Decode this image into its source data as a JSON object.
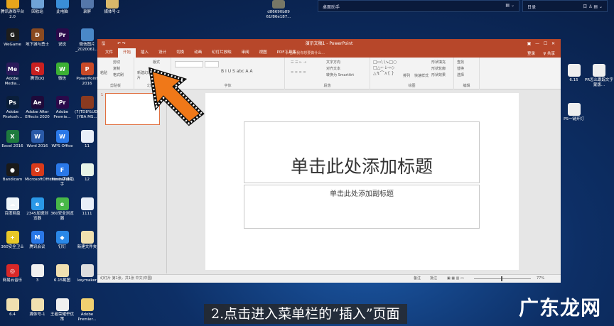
{
  "desktop": {
    "top_icons": [
      {
        "label": "腾讯游戏平台 2.0",
        "color": "#e7a51c"
      },
      {
        "label": "回收站",
        "color": "#6fa3d8"
      },
      {
        "label": "此电脑",
        "color": "#3a8ed8"
      },
      {
        "label": "录屏",
        "color": "#5577aa"
      },
      {
        "label": "媒体号-2",
        "color": "#d9b86a"
      }
    ],
    "left_icons": [
      {
        "label": "WeGame",
        "glyph": "G",
        "color": "#1d1d1d"
      },
      {
        "label": "地下城与勇士",
        "glyph": "D",
        "color": "#8a4a20"
      },
      {
        "label": "说说",
        "glyph": "Pr",
        "color": "#2a0a4a"
      },
      {
        "label": "微信图片_2020061...",
        "glyph": "",
        "color": "#4a88c8"
      },
      {
        "label": "Adobe Media...",
        "glyph": "Me",
        "color": "#2a1a5a"
      },
      {
        "label": "腾讯QQ",
        "glyph": "Q",
        "color": "#c82020"
      },
      {
        "label": "微信",
        "glyph": "W",
        "color": "#3cb034"
      },
      {
        "label": "PowerPoint 2016",
        "glyph": "P",
        "color": "#c84a28"
      },
      {
        "label": "Adobe Photosh...",
        "glyph": "Ps",
        "color": "#0a1e3a"
      },
      {
        "label": "Adobe After Effects 2020",
        "glyph": "Ae",
        "color": "#1e0a3a"
      },
      {
        "label": "Adobe Premie...",
        "glyph": "Pr",
        "color": "#2a0a4a"
      },
      {
        "label": "(7)TD8%UD~[YBA MS...",
        "glyph": "",
        "color": "#8a3a20"
      },
      {
        "label": "Excel 2016",
        "glyph": "X",
        "color": "#1e7a3e"
      },
      {
        "label": "Word 2016",
        "glyph": "W",
        "color": "#2a5aa8"
      },
      {
        "label": "WPS Office",
        "glyph": "W",
        "color": "#2a78e8"
      },
      {
        "label": "11",
        "glyph": "",
        "color": "#e8eef8"
      },
      {
        "label": "Bandicam",
        "glyph": "●",
        "color": "#1a1a1a"
      },
      {
        "label": "MicrosoftOfficeInstallati...",
        "glyph": "O",
        "color": "#d83a1a"
      },
      {
        "label": "iFonts字体助手",
        "glyph": "F",
        "color": "#2a78e8"
      },
      {
        "label": "12",
        "glyph": "",
        "color": "#e8f4e8"
      },
      {
        "label": "百度网盘",
        "glyph": "☁",
        "color": "#f0f6fa"
      },
      {
        "label": "2345加速浏览器",
        "glyph": "e",
        "color": "#2a98e8"
      },
      {
        "label": "360安全浏览器",
        "glyph": "e",
        "color": "#48b848"
      },
      {
        "label": "1111",
        "glyph": "",
        "color": "#e8eef8"
      },
      {
        "label": "360安全卫士",
        "glyph": "+",
        "color": "#e8c828"
      },
      {
        "label": "腾讯会议",
        "glyph": "M",
        "color": "#2a78e8"
      },
      {
        "label": "钉钉",
        "glyph": "◆",
        "color": "#2a88e8"
      },
      {
        "label": "新建文件夹",
        "glyph": "",
        "color": "#f0e0b0"
      },
      {
        "label": "网易云音乐",
        "glyph": "◎",
        "color": "#d82828"
      },
      {
        "label": "3",
        "glyph": "",
        "color": "#f0f0f0"
      },
      {
        "label": "6.15截图",
        "glyph": "",
        "color": "#f0e0b0"
      },
      {
        "label": "keymaker",
        "glyph": "",
        "color": "#ddd"
      },
      {
        "label": "6.4",
        "glyph": "",
        "color": "#f0e0b0"
      },
      {
        "label": "媒体号-1",
        "glyph": "",
        "color": "#f0e0b0"
      },
      {
        "label": "王者荣耀举优策",
        "glyph": "",
        "color": "#f0f0f0"
      },
      {
        "label": "Adobe Premier...",
        "glyph": "",
        "color": "#f0d070"
      }
    ],
    "mid_icon": {
      "label": "d86690b89 61f86e187..."
    },
    "right_icons": [
      {
        "label": "6.15"
      },
      {
        "label": "PR怎么跟踪文字蒙版..."
      },
      {
        "label": "PS一键开灯"
      }
    ],
    "widgets": [
      {
        "title": "桌面助手"
      },
      {
        "title": "日录"
      }
    ]
  },
  "ppt": {
    "title": "演示文稿1 - PowerPoint",
    "tabs": [
      "文件",
      "开始",
      "插入",
      "设计",
      "切换",
      "动画",
      "幻灯片放映",
      "审阅",
      "视图",
      "PDF工具集"
    ],
    "tell_me": "♀ 告诉我你想要做什么...",
    "login": "登录",
    "share": "♀ 共享",
    "ribbon": {
      "clipboard": {
        "paste": "粘贴",
        "cut": "剪切",
        "copy": "复制",
        "format_painter": "格式刷",
        "label": "剪贴板"
      },
      "slides": {
        "new_slide": "新建幻灯片",
        "layout": "版式",
        "label": "幻灯片"
      },
      "font": {
        "label": "字体"
      },
      "paragraph": {
        "text_direction": "文字方向",
        "align_text": "对齐文本",
        "smartart": "转换为 SmartArt",
        "label": "段落"
      },
      "drawing": {
        "arrange": "排列",
        "quick_styles": "快速样式",
        "fill": "形状填充",
        "outline": "形状轮廓",
        "effects": "形状效果",
        "label": "绘图"
      },
      "editing": {
        "find": "查找",
        "replace": "替换",
        "select": "选择",
        "label": "编辑"
      }
    },
    "thumb_num": "1",
    "slide": {
      "title_placeholder": "单击此处添加标题",
      "subtitle_placeholder": "单击此处添加副标题"
    },
    "status": {
      "left": "幻灯片 第1张，共1张    中文(中国)",
      "notes": "备注",
      "comments": "批注",
      "zoom": "77%"
    }
  },
  "caption": "2.点击进入菜单栏的“插入”页面",
  "watermark": "广东龙网"
}
